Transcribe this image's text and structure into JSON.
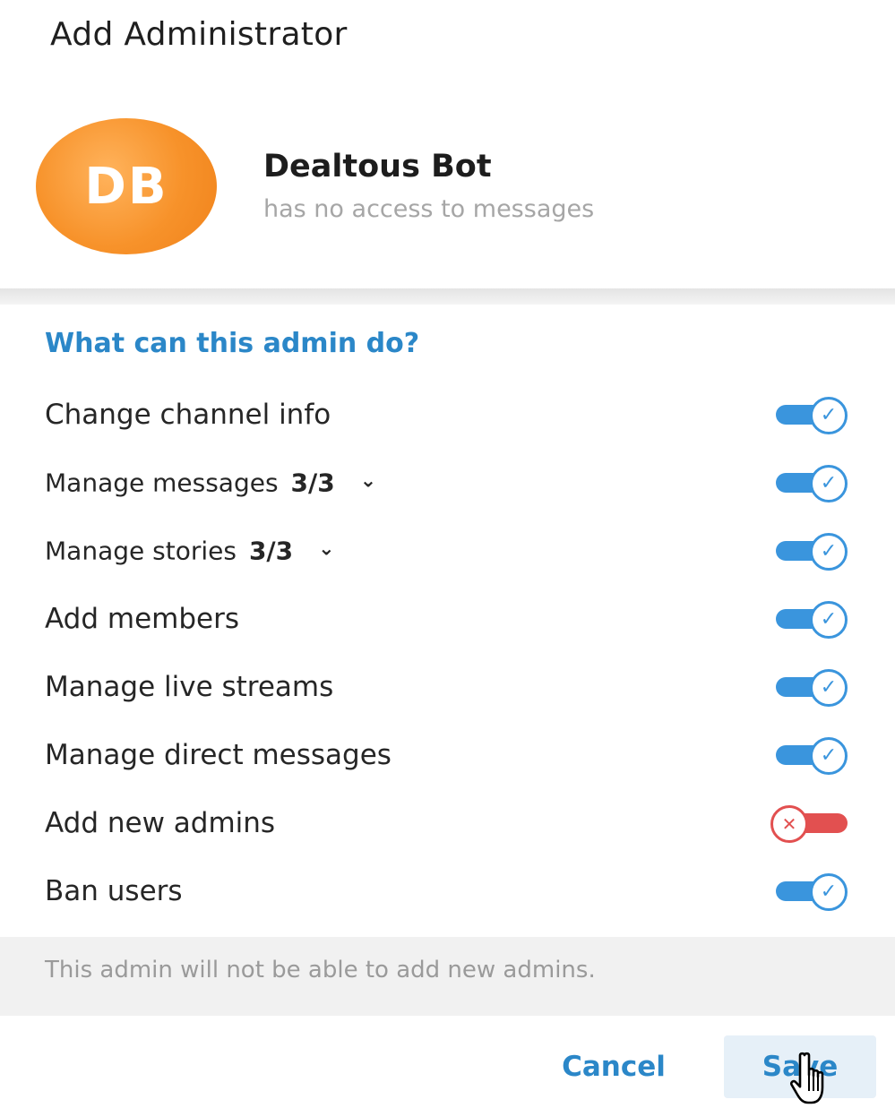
{
  "dialog": {
    "title": "Add Administrator"
  },
  "profile": {
    "initials": "DB",
    "name": "Dealtous Bot",
    "status": "has no access to messages",
    "avatar_color": "#f7922a"
  },
  "permissions": {
    "header": "What can this admin do?",
    "items": [
      {
        "label": "Change channel info",
        "count": "",
        "expandable": false,
        "enabled": true
      },
      {
        "label": "Manage messages",
        "count": "3/3",
        "expandable": true,
        "enabled": true
      },
      {
        "label": "Manage stories",
        "count": "3/3",
        "expandable": true,
        "enabled": true
      },
      {
        "label": "Add members",
        "count": "",
        "expandable": false,
        "enabled": true
      },
      {
        "label": "Manage live streams",
        "count": "",
        "expandable": false,
        "enabled": true
      },
      {
        "label": "Manage direct messages",
        "count": "",
        "expandable": false,
        "enabled": true
      },
      {
        "label": "Add new admins",
        "count": "",
        "expandable": false,
        "enabled": false
      },
      {
        "label": "Ban users",
        "count": "",
        "expandable": false,
        "enabled": true
      }
    ]
  },
  "footnote": "This admin will not be able to add new admins.",
  "actions": {
    "cancel_label": "Cancel",
    "save_label": "Save"
  },
  "colors": {
    "accent": "#2b87c8",
    "toggle_on": "#3a95dd",
    "toggle_off": "#e25050"
  },
  "icons": {
    "toggle_on": "check-icon",
    "toggle_off": "x-icon",
    "expand": "chevron-down-icon",
    "cursor": "hand-pointer-cursor"
  }
}
